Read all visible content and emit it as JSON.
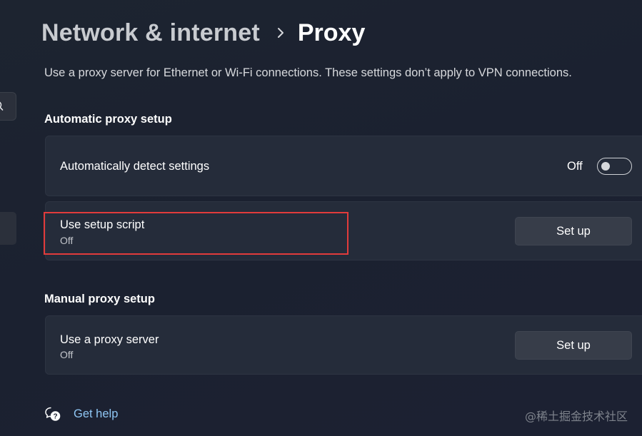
{
  "breadcrumb": {
    "parent": "Network & internet",
    "current": "Proxy"
  },
  "description": "Use a proxy server for Ethernet or Wi-Fi connections. These settings don’t apply to VPN connections.",
  "automatic": {
    "title": "Automatic proxy setup",
    "detect": {
      "label": "Automatically detect settings",
      "state": "Off"
    },
    "script": {
      "label": "Use setup script",
      "status": "Off",
      "button": "Set up"
    }
  },
  "manual": {
    "title": "Manual proxy setup",
    "proxy": {
      "label": "Use a proxy server",
      "status": "Off",
      "button": "Set up"
    }
  },
  "help": {
    "label": "Get help",
    "icon": "help-chat-icon"
  },
  "watermark": "@稀土掘金技术社区",
  "colors": {
    "accent_link": "#8fc6f4",
    "highlight": "#e23b3b",
    "card": "#252c3a"
  }
}
